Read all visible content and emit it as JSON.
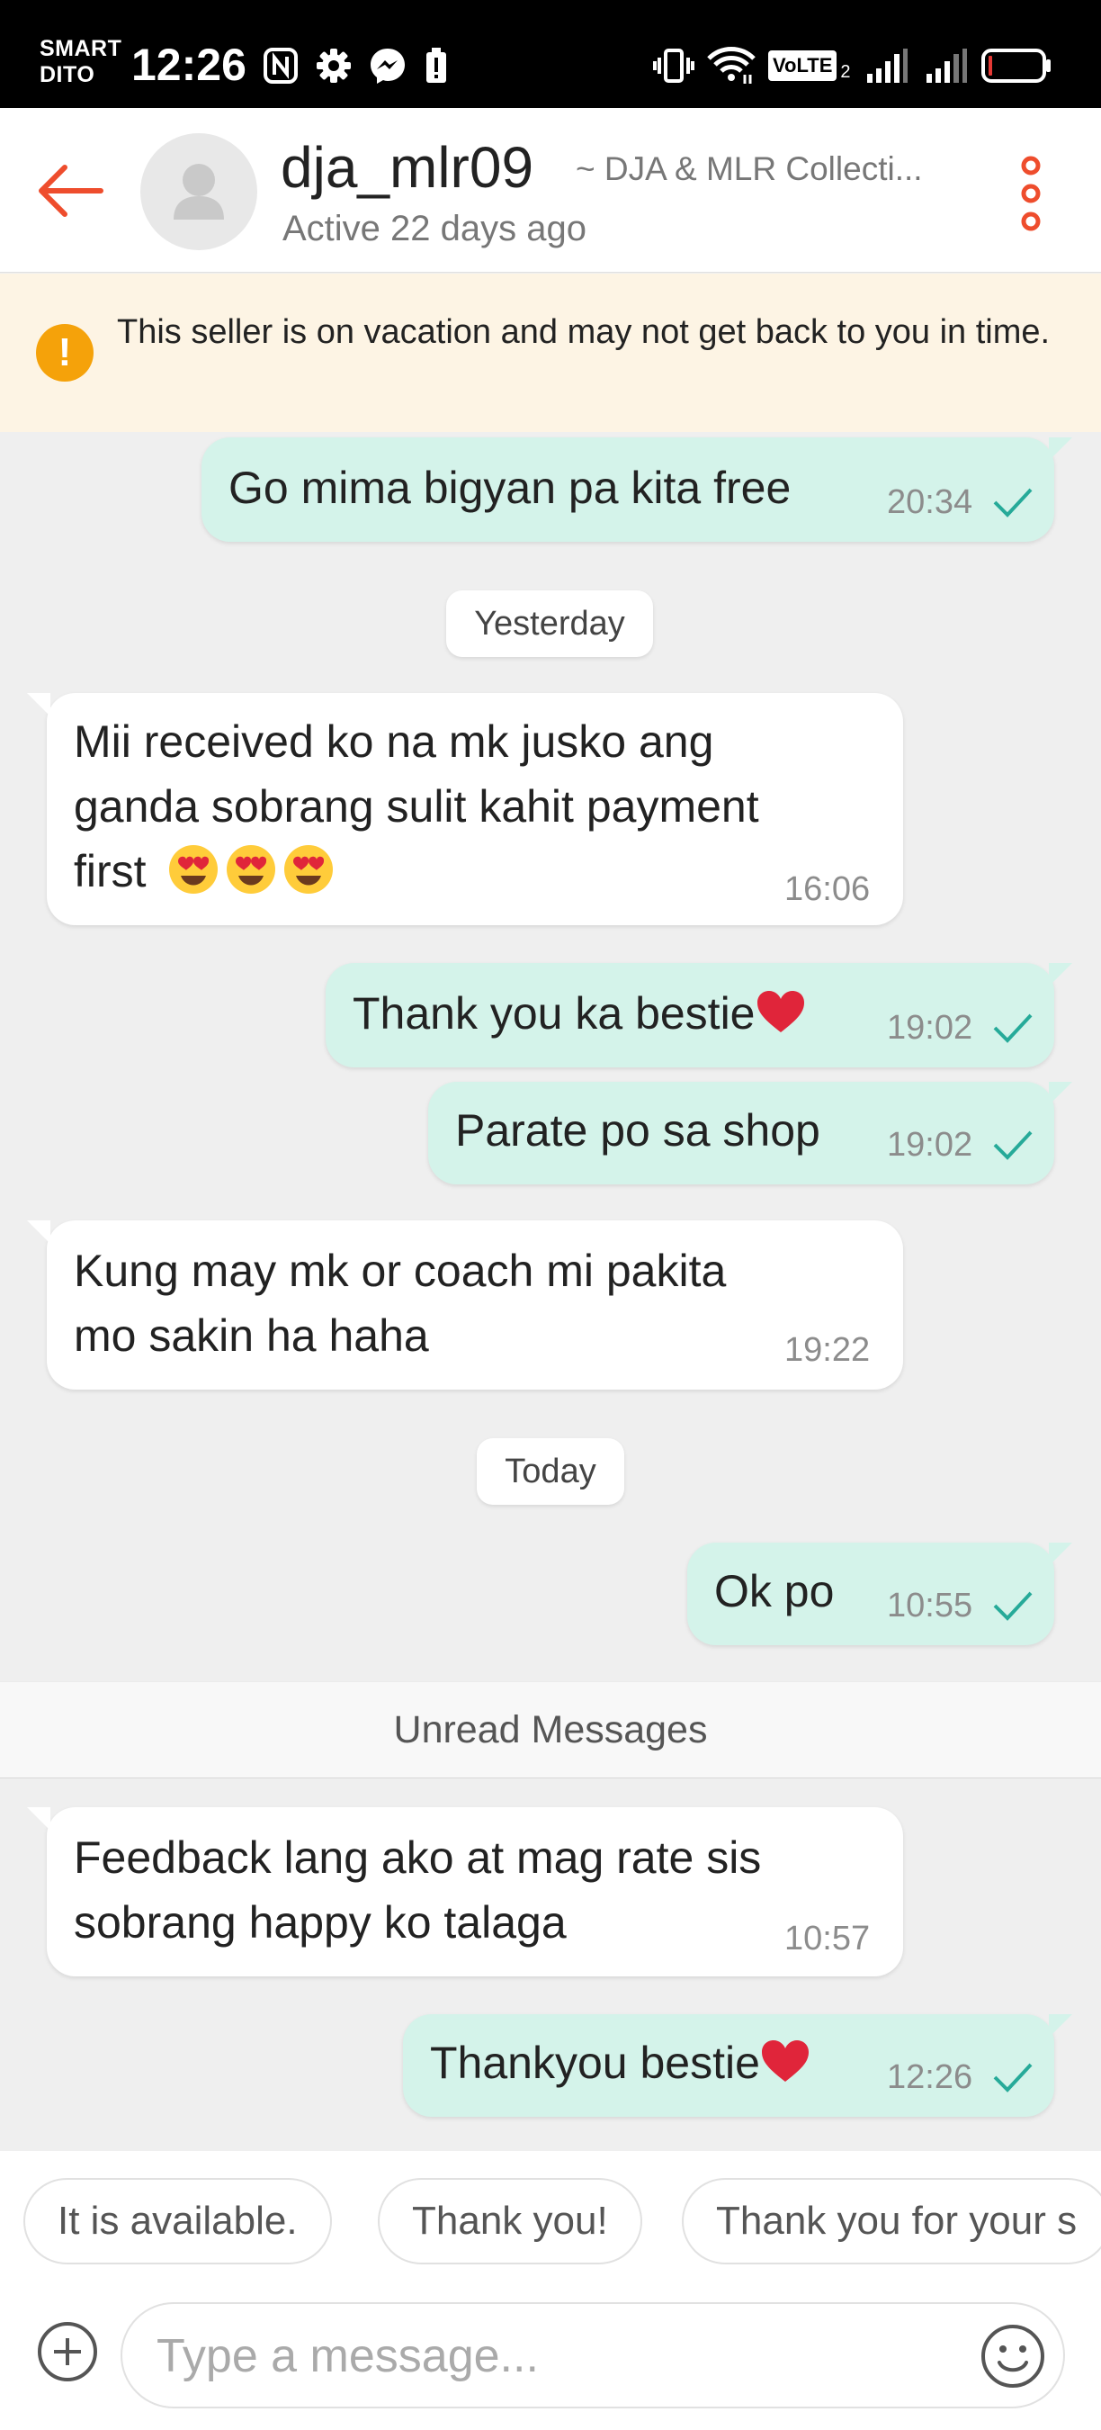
{
  "status_bar": {
    "carrier_line1": "SMART",
    "carrier_line2": "DITO",
    "time": "12:26",
    "volte_label": "VoLTE",
    "volte_sub": "2"
  },
  "header": {
    "username": "dja_mlr09",
    "shop_name": "~ DJA & MLR Collecti...",
    "active_status": "Active 22 days ago"
  },
  "notice": {
    "text": "This seller is on vacation and may not get back to you in time."
  },
  "colors": {
    "accent": "#ee4d2d",
    "outgoing_bubble": "#d4f3ea",
    "incoming_bubble": "#ffffff",
    "check": "#26aa99",
    "warning": "#f5a20a"
  },
  "messages": [
    {
      "direction": "outgoing",
      "text": "Go mima bigyan pa kita free",
      "time": "20:34",
      "read": true
    },
    {
      "type": "date",
      "label": "Yesterday"
    },
    {
      "direction": "incoming",
      "line1": "Mii received ko na mk jusko ang",
      "line2": "ganda sobrang sulit kahit payment",
      "line3": "first",
      "emoji": "smiling-face-with-heart-eyes x3",
      "time": "16:06"
    },
    {
      "direction": "outgoing",
      "text": "Thank you ka bestie",
      "emoji": "red-heart",
      "time": "19:02",
      "read": true
    },
    {
      "direction": "outgoing",
      "text": "Parate po sa shop",
      "time": "19:02",
      "read": true
    },
    {
      "direction": "incoming",
      "line1": "Kung may mk or coach mi pakita",
      "line2": "mo sakin ha haha",
      "time": "19:22"
    },
    {
      "type": "date",
      "label": "Today"
    },
    {
      "direction": "outgoing",
      "text": "Ok po",
      "time": "10:55",
      "read": true
    },
    {
      "type": "divider",
      "label": "Unread Messages"
    },
    {
      "direction": "incoming",
      "line1": "Feedback lang ako at mag rate sis",
      "line2": "sobrang happy ko talaga",
      "time": "10:57"
    },
    {
      "direction": "outgoing",
      "text": "Thankyou bestie",
      "emoji": "red-heart",
      "time": "12:26",
      "read": true
    }
  ],
  "quick_replies": [
    "It is available.",
    "Thank you!",
    "Thank you for your s"
  ],
  "input": {
    "placeholder": "Type a message..."
  }
}
